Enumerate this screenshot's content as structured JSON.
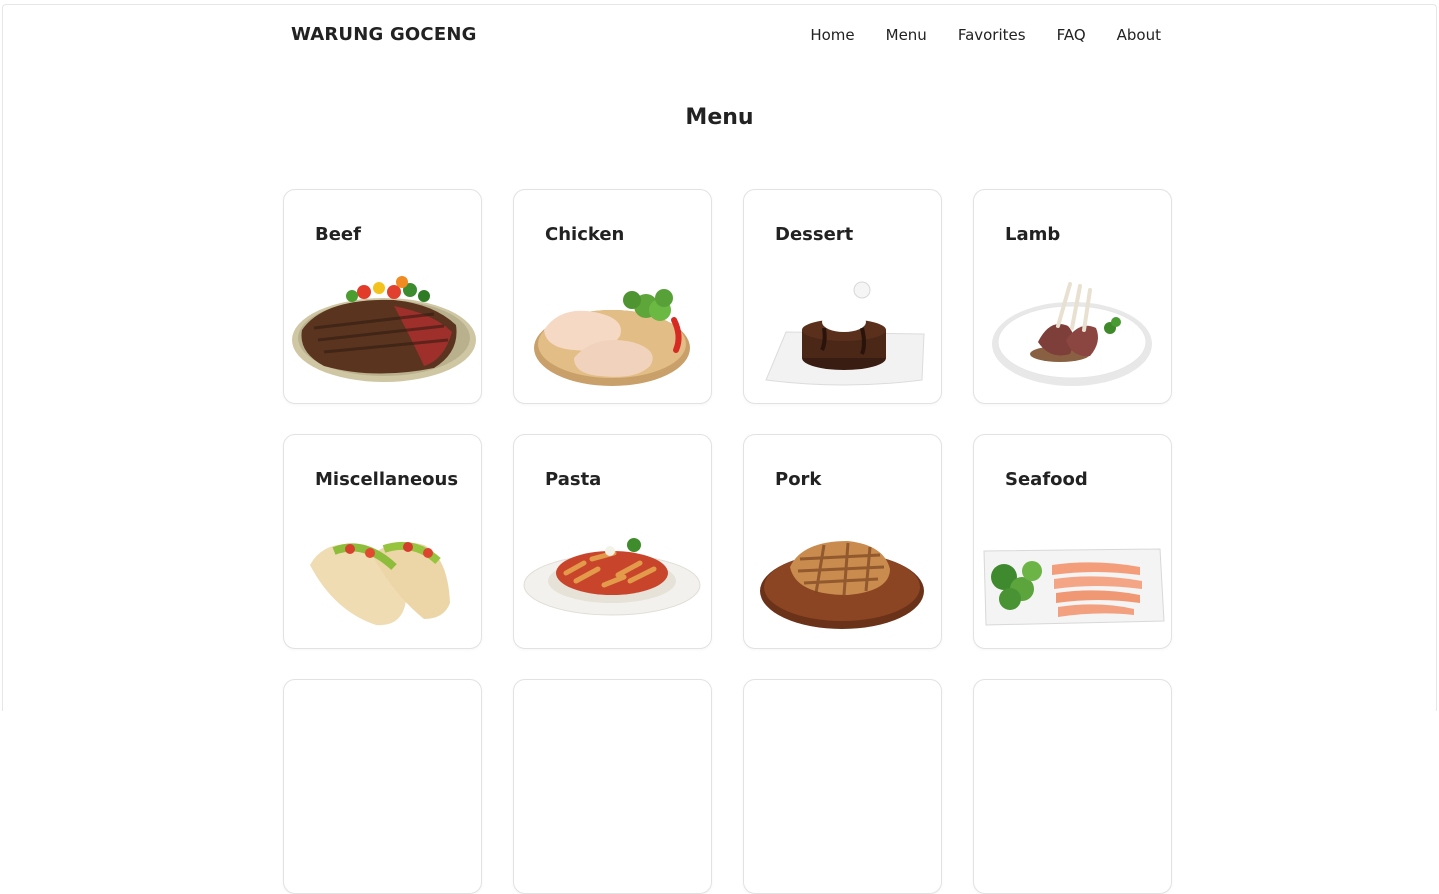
{
  "header": {
    "brand": "WARUNG GOCENG",
    "nav": [
      {
        "label": "Home",
        "icon": "home"
      },
      {
        "label": "Menu",
        "icon": "menu"
      },
      {
        "label": "Favorites",
        "icon": "favorites"
      },
      {
        "label": "FAQ",
        "icon": "faq"
      },
      {
        "label": "About",
        "icon": "about"
      }
    ]
  },
  "main": {
    "title": "Menu",
    "categories": [
      {
        "name": "Beef",
        "image": "beef-steak-icon"
      },
      {
        "name": "Chicken",
        "image": "chicken-legs-icon"
      },
      {
        "name": "Dessert",
        "image": "chocolate-cake-icon"
      },
      {
        "name": "Lamb",
        "image": "lamb-chops-icon"
      },
      {
        "name": "Miscellaneous",
        "image": "tacos-icon"
      },
      {
        "name": "Pasta",
        "image": "penne-pasta-icon"
      },
      {
        "name": "Pork",
        "image": "pork-chop-icon"
      },
      {
        "name": "Seafood",
        "image": "salmon-sashimi-icon"
      },
      {
        "name": "",
        "image": ""
      },
      {
        "name": "",
        "image": ""
      },
      {
        "name": "",
        "image": ""
      },
      {
        "name": "",
        "image": ""
      }
    ]
  }
}
